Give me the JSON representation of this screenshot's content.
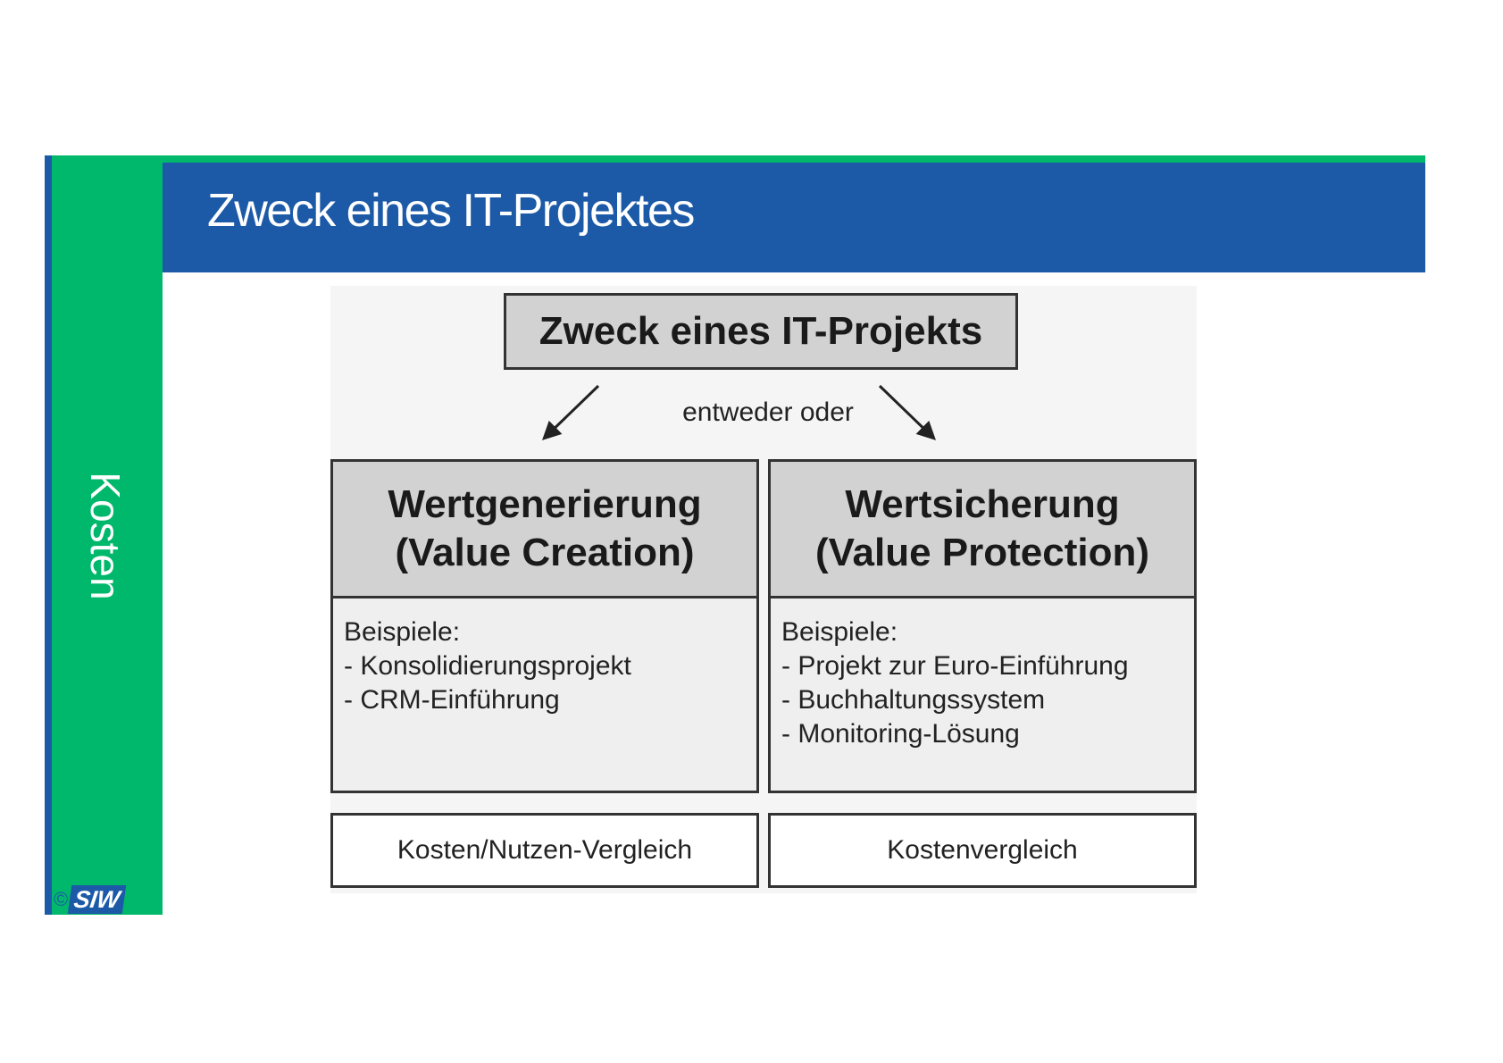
{
  "slide": {
    "side_label": "Kosten",
    "title": "Zweck eines IT-Projektes",
    "logo_copyright": "©",
    "logo_text": "SIW"
  },
  "diagram": {
    "top_box": "Zweck eines IT-Projekts",
    "connector_label": "entweder oder",
    "left": {
      "heading_line1": "Wertgenerierung",
      "heading_line2": "(Value Creation)",
      "examples_label": "Beispiele:",
      "examples": [
        "- Konsolidierungsprojekt",
        "- CRM-Einführung"
      ],
      "method": "Kosten/Nutzen-Vergleich"
    },
    "right": {
      "heading_line1": "Wertsicherung",
      "heading_line2": "(Value Protection)",
      "examples_label": "Beispiele:",
      "examples": [
        "- Projekt zur Euro-Einführung",
        "- Buchhaltungssystem",
        "- Monitoring-Lösung"
      ],
      "method": "Kostenvergleich"
    }
  },
  "colors": {
    "brand_blue": "#1c5aa8",
    "brand_green": "#00b86b",
    "box_gray": "#d2d2d2"
  }
}
